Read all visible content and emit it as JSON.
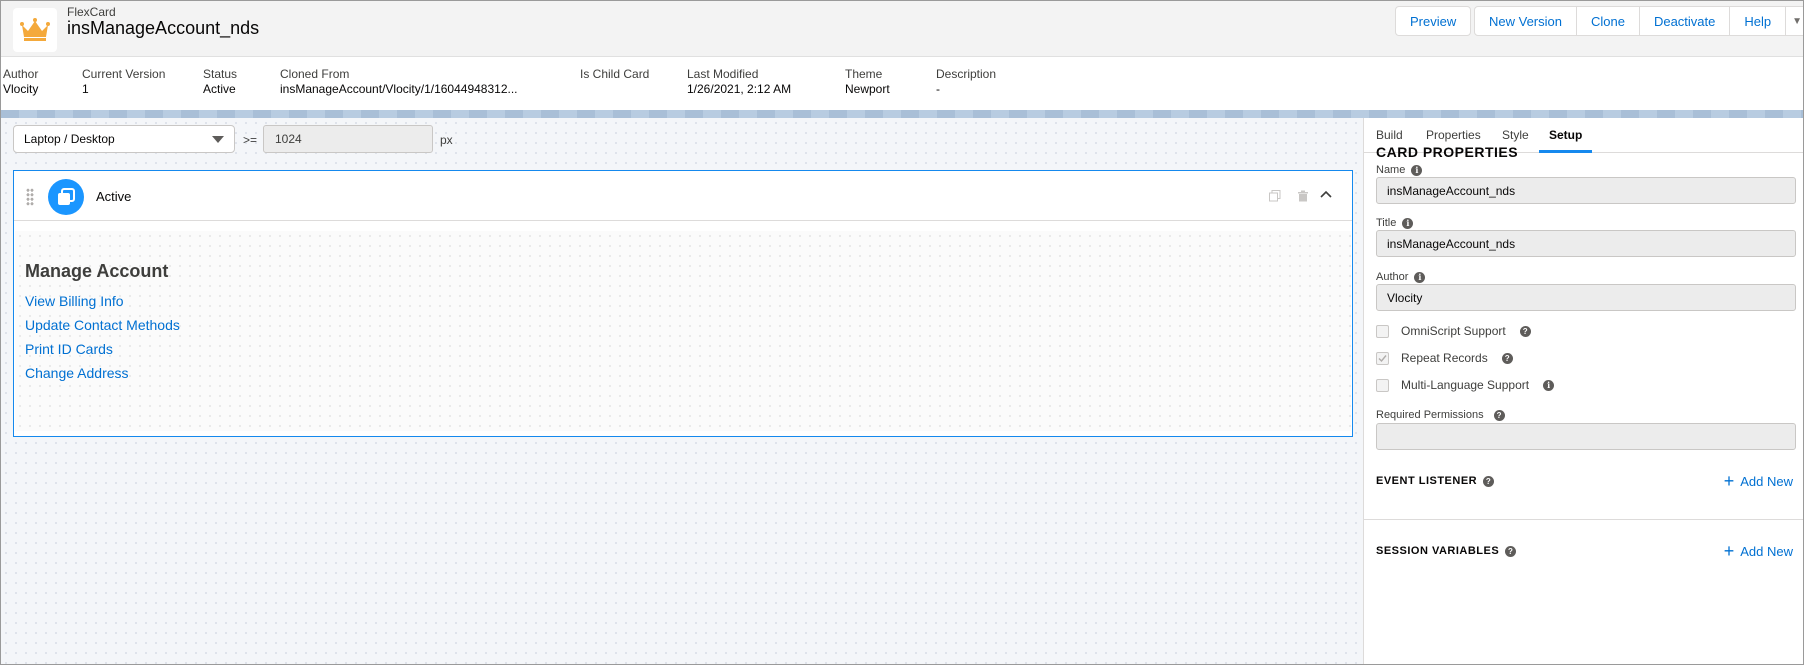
{
  "header": {
    "type_label": "FlexCard",
    "title": "insManageAccount_nds",
    "buttons": {
      "preview": "Preview",
      "new_version": "New Version",
      "clone": "Clone",
      "deactivate": "Deactivate",
      "help": "Help"
    }
  },
  "meta": {
    "author": {
      "label": "Author",
      "value": "Vlocity"
    },
    "current_version": {
      "label": "Current Version",
      "value": "1"
    },
    "status": {
      "label": "Status",
      "value": "Active"
    },
    "cloned_from": {
      "label": "Cloned From",
      "value": "insManageAccount/Vlocity/1/16044948312..."
    },
    "is_child_card": {
      "label": "Is Child Card",
      "value": ""
    },
    "last_modified": {
      "label": "Last Modified",
      "value": "1/26/2021, 2:12 AM"
    },
    "theme": {
      "label": "Theme",
      "value": "Newport"
    },
    "description": {
      "label": "Description",
      "value": "-"
    }
  },
  "canvas": {
    "device_select": "Laptop / Desktop",
    "ge_label": ">=",
    "width_value": "1024",
    "px_label": "px",
    "state": {
      "name": "Active",
      "card_title": "Manage Account",
      "links": [
        "View Billing Info",
        "Update Contact Methods",
        "Print ID Cards",
        "Change Address"
      ]
    }
  },
  "panel": {
    "tabs": [
      "Build",
      "Properties",
      "Style",
      "Setup"
    ],
    "active_tab": "Setup",
    "card_properties_title": "CARD PROPERTIES",
    "name_label": "Name",
    "name_value": "insManageAccount_nds",
    "title_label": "Title",
    "title_value": "insManageAccount_nds",
    "author_label": "Author",
    "author_value": "Vlocity",
    "omniscript_support": "OmniScript Support",
    "repeat_records": "Repeat Records",
    "multi_language_support": "Multi-Language Support",
    "required_permissions_label": "Required Permissions",
    "required_permissions_value": "",
    "event_listener_title": "EVENT LISTENER",
    "session_variables_title": "SESSION VARIABLES",
    "add_new": "Add New"
  },
  "colors": {
    "brand_blue": "#0070d2",
    "accent_blue": "#1589ee",
    "crown_orange": "#f4a93b"
  }
}
